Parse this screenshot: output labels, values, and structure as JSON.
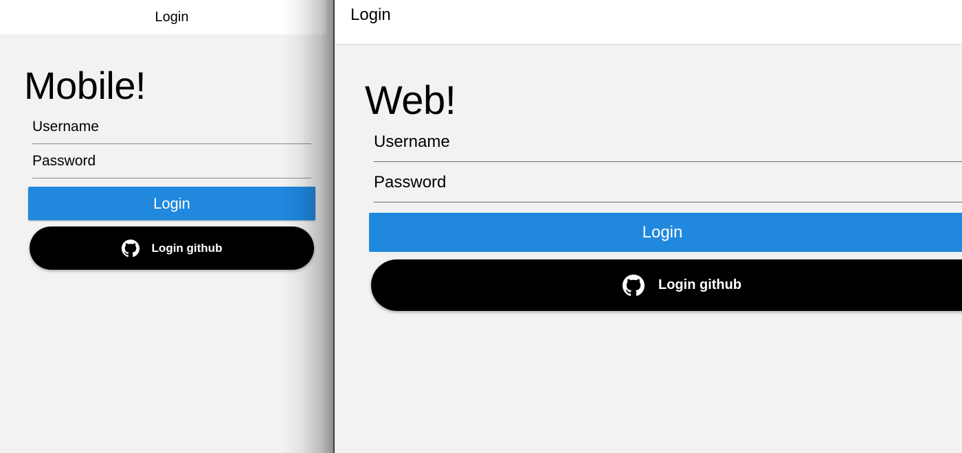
{
  "mobile": {
    "nav_title": "Login",
    "heading": "Mobile!",
    "username_placeholder": "Username",
    "password_placeholder": "Password",
    "login_button": "Login",
    "github_button": "Login github"
  },
  "web": {
    "nav_title": "Login",
    "heading": "Web!",
    "username_placeholder": "Username",
    "password_placeholder": "Password",
    "login_button": "Login",
    "github_button": "Login github"
  },
  "colors": {
    "primary": "#2088dd",
    "github_button": "#000000",
    "background": "#f2f2f2",
    "navbar": "#ffffff"
  },
  "icons": {
    "github": "github-icon"
  }
}
